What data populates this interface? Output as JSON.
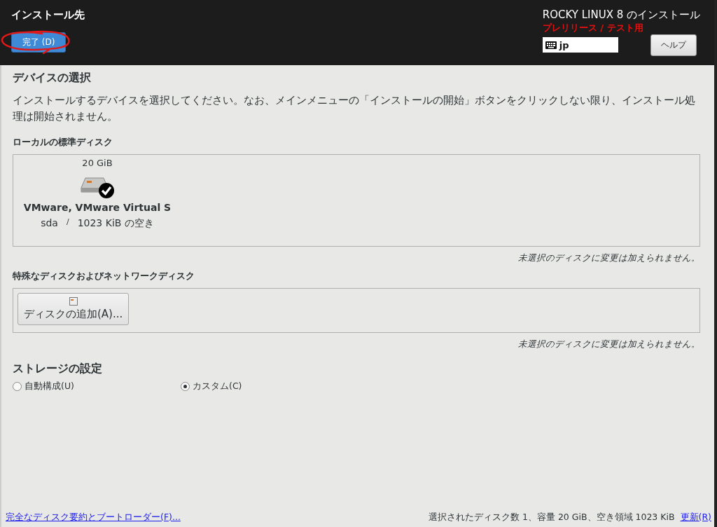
{
  "header": {
    "title": "インストール先",
    "done_button": "完了 (D)",
    "product": "ROCKY LINUX 8 のインストール",
    "prerelease": "プレリリース / テスト用",
    "keyboard_layout": "jp",
    "help_button": "ヘルプ"
  },
  "device_selection": {
    "heading": "デバイスの選択",
    "description": "インストールするデバイスを選択してください。なお、メインメニューの「インストールの開始」ボタンをクリックしない限り、インストール処理は開始されません。"
  },
  "local_disks": {
    "heading": "ローカルの標準ディスク",
    "disks": [
      {
        "size": "20 GiB",
        "name": "VMware, VMware Virtual S",
        "device": "sda",
        "separator": "/",
        "free": "1023 KiB の空き",
        "selected": true
      }
    ],
    "note": "未選択のディスクに変更は加えられません。"
  },
  "special_disks": {
    "heading": "特殊なディスクおよびネットワークディスク",
    "add_button": "ディスクの追加(A)...",
    "note": "未選択のディスクに変更は加えられません。"
  },
  "storage": {
    "heading": "ストレージの設定",
    "options": [
      {
        "label": "自動構成(U)",
        "selected": false
      },
      {
        "label": "カスタム(C)",
        "selected": true
      }
    ]
  },
  "footer": {
    "summary_link": "完全なディスク要約とブートローダー(F)...",
    "status": "選択されたディスク数 1、容量 20 GiB、空き領域 1023 KiB",
    "refresh_link": "更新(R)"
  }
}
